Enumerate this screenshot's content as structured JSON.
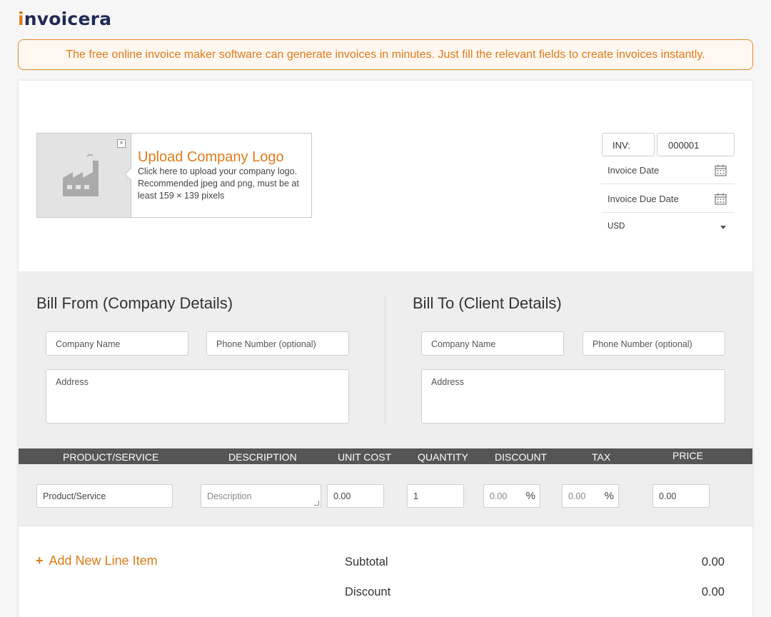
{
  "brand": {
    "name_pre": "i",
    "name_rest": "nvoicera"
  },
  "banner": {
    "text": "The free online invoice maker software can generate invoices in minutes. Just fill the relevant fields to create invoices instantly."
  },
  "logo_upload": {
    "title": "Upload Company Logo",
    "description": "Click here to upload your company logo. Recommended jpeg and png, must be at least 159 × 139 pixels",
    "close": "×"
  },
  "invoice_meta": {
    "prefix": "INV:",
    "number": "000001",
    "date_placeholder": "Invoice Date",
    "due_date_placeholder": "Invoice Due Date",
    "currency": "USD"
  },
  "bill_from": {
    "title": "Bill From (Company Details)",
    "company_placeholder": "Company Name",
    "phone_placeholder": "Phone Number (optional)",
    "address_placeholder": "Address"
  },
  "bill_to": {
    "title": "Bill To (Client Details)",
    "company_placeholder": "Company Name",
    "phone_placeholder": "Phone Number (optional)",
    "address_placeholder": "Address"
  },
  "table": {
    "headers": [
      "PRODUCT/SERVICE",
      "DESCRIPTION",
      "UNIT COST",
      "QUANTITY",
      "DISCOUNT",
      "TAX",
      "PRICE"
    ],
    "row": {
      "product_placeholder": "Product/Service",
      "description_placeholder": "Description",
      "unit_cost": "0.00",
      "quantity": "1",
      "discount_placeholder": "0.00",
      "tax_placeholder": "0.00",
      "percent": "%",
      "price": "0.00"
    }
  },
  "add_line": {
    "plus": "+",
    "label": "Add New Line Item"
  },
  "summary": {
    "subtotal_label": "Subtotal",
    "subtotal_value": "0.00",
    "discount_label": "Discount",
    "discount_value": "0.00"
  },
  "colors": {
    "accent": "#e07b1a",
    "brand_dark": "#1f2a55",
    "header_bg": "#555555",
    "section_bg": "#eeeeee"
  }
}
